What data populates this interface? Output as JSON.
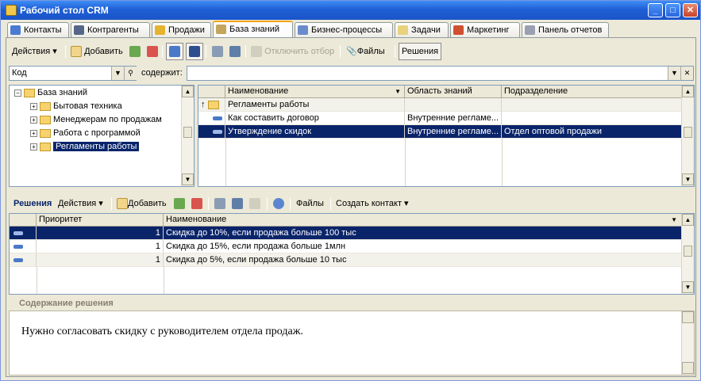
{
  "window": {
    "title": "Рабочий стол CRM",
    "btn_min": "_",
    "btn_max": "□",
    "btn_close": "✕"
  },
  "tabs": [
    {
      "label": "Контакты",
      "color": "#4a7bd1"
    },
    {
      "label": "Контрагенты",
      "color": "#556688"
    },
    {
      "label": "Продажи",
      "color": "#e4b42f"
    },
    {
      "label": "База знаний",
      "color": "#c5a45d"
    },
    {
      "label": "Бизнес-процессы",
      "color": "#6b8ccc"
    },
    {
      "label": "Задачи",
      "color": "#e8d27c"
    },
    {
      "label": "Маркетинг",
      "color": "#d05030"
    },
    {
      "label": "Панель отчетов",
      "color": "#9aa0b0"
    }
  ],
  "toolbar": {
    "actions": "Действия",
    "add": "Добавить",
    "disable_filter": "Отключить отбор",
    "files": "Файлы",
    "solutions": "Решения"
  },
  "filter": {
    "field": "Код",
    "contains_label": "содержит:",
    "value": ""
  },
  "tree": [
    {
      "label": "База знаний",
      "expander": "−",
      "level": 0
    },
    {
      "label": "Бытовая техника",
      "expander": "+",
      "level": 1
    },
    {
      "label": "Менеджерам по продажам",
      "expander": "+",
      "level": 1
    },
    {
      "label": "Работа с программой",
      "expander": "+",
      "level": 1
    },
    {
      "label": "Регламенты работы",
      "expander": "+",
      "level": 1,
      "selected": true
    }
  ],
  "articles": {
    "columns": [
      "Наименование",
      "Область знаний",
      "Подразделение"
    ],
    "rows": [
      {
        "type": "folder",
        "name": "Регламенты работы",
        "area": "",
        "dept": ""
      },
      {
        "type": "item",
        "name": "Как составить договор",
        "area": "Внутренние регламе...",
        "dept": ""
      },
      {
        "type": "item",
        "name": "Утверждение скидок",
        "area": "Внутренние регламе...",
        "dept": "Отдел оптовой продажи",
        "selected": true
      }
    ]
  },
  "solutions_toolbar": {
    "title": "Решения",
    "actions": "Действия",
    "add": "Добавить",
    "files": "Файлы",
    "create_contact": "Создать контакт"
  },
  "solutions": {
    "columns": [
      "Приоритет",
      "Наименование"
    ],
    "rows": [
      {
        "priority": "1",
        "name": "Скидка до 10%, если продажа больше 100 тыс",
        "selected": true
      },
      {
        "priority": "1",
        "name": "Скидка до 15%, если продажа больше 1млн"
      },
      {
        "priority": "1",
        "name": "Скидка до 5%, если продажа больше 10 тыс"
      }
    ]
  },
  "solution_content": {
    "label": "Содержание решения",
    "text": "Нужно согласовать скидку с руководителем отдела продаж."
  }
}
